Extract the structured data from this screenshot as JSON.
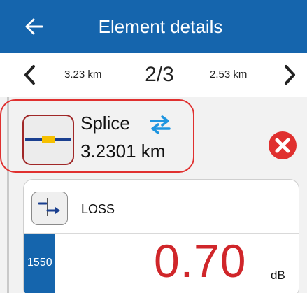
{
  "header": {
    "title": "Element details",
    "back_icon": "arrow-left-icon",
    "background_color": "#1565ad"
  },
  "navigation": {
    "prev_icon": "chevron-left-icon",
    "next_icon": "chevron-right-icon",
    "prev_distance": "3.23 km",
    "position": "2/3",
    "next_distance": "2.53 km"
  },
  "element": {
    "type": "Splice",
    "distance": "3.2301 km",
    "icon": "splice-icon",
    "swap_icon": "swap-arrows-icon",
    "delete_icon": "close-circle-icon",
    "highlight_color": "#e0302f"
  },
  "loss_card": {
    "icon": "loss-icon",
    "label": "LOSS",
    "wavelength": "1550",
    "value": "0.70",
    "unit": "dB",
    "value_color": "#d0262a"
  }
}
